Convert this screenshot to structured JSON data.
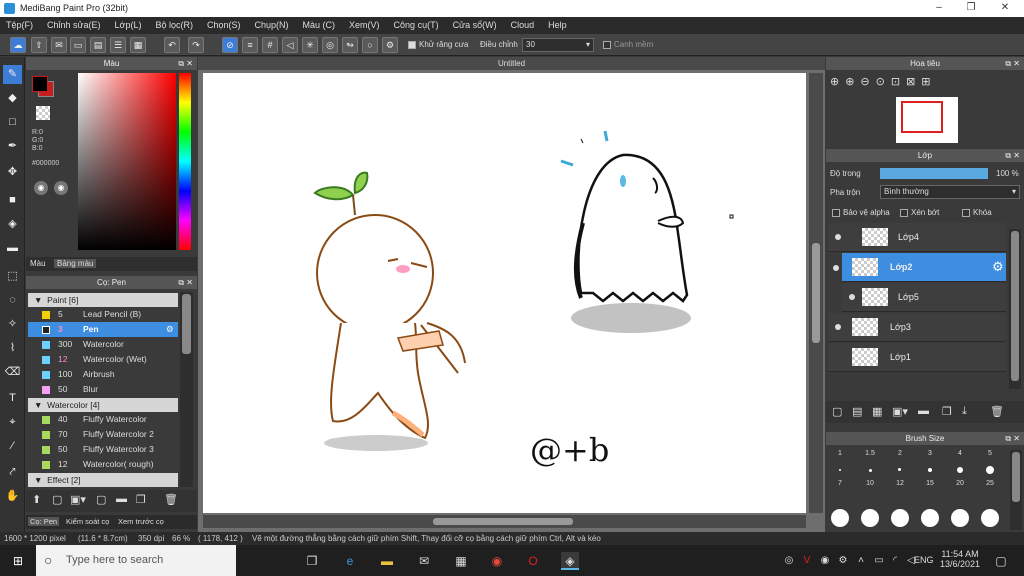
{
  "window": {
    "title": "MediBang Paint Pro (32bit)",
    "minimize": "–",
    "maximize": "❐",
    "close": "✕"
  },
  "menu": [
    "Tệp(F)",
    "Chỉnh sửa(E)",
    "Lớp(L)",
    "Bộ lọc(R)",
    "Chọn(S)",
    "Chụp(N)",
    "Màu (C)",
    "Xem(V)",
    "Công cụ(T)",
    "Cửa sổ(W)",
    "Cloud",
    "Help"
  ],
  "toolbar": {
    "antialias": "Khử răng cưa",
    "adjust_label": "Điều chỉnh",
    "adjust_value": "30",
    "smooth_label": "Canh mềm"
  },
  "color_panel": {
    "title": "Màu",
    "r": "R:0",
    "g": "G:0",
    "b": "B:0",
    "hex": "#000000",
    "tab1": "Màu",
    "tab2": "Bảng màu",
    "fg": "#000000",
    "bg": "#c41e1e"
  },
  "brush_panel": {
    "title": "Cọ: Pen",
    "groups": [
      {
        "name": "Paint [6]",
        "items": [
          {
            "size": "5",
            "name": "Lead Pencil (B)",
            "color": "#f5d000"
          },
          {
            "size": "3",
            "name": "Pen",
            "color": "#222222",
            "selected": true
          },
          {
            "size": "300",
            "name": "Watercolor",
            "color": "#6fd0ff"
          },
          {
            "size": "12",
            "name": "Watercolor (Wet)",
            "color": "#6fd0ff"
          },
          {
            "size": "100",
            "name": "Airbrush",
            "color": "#6fd0ff"
          },
          {
            "size": "50",
            "name": "Blur",
            "color": "#f5a0f5"
          }
        ]
      },
      {
        "name": "Watercolor [4]",
        "items": [
          {
            "size": "40",
            "name": "Fluffy Watercolor",
            "color": "#a8d860"
          },
          {
            "size": "70",
            "name": "Fluffy Watercolor 2",
            "color": "#a8d860"
          },
          {
            "size": "50",
            "name": "Fluffy Watercolor 3",
            "color": "#a8d860"
          },
          {
            "size": "12",
            "name": "Watercolor( rough)",
            "color": "#a8d860"
          }
        ]
      },
      {
        "name": "Effect [2]",
        "items": []
      }
    ],
    "tabs": [
      "Cọ: Pen",
      "Kiểm soát cọ",
      "Xem trước cọ"
    ]
  },
  "canvas": {
    "title": "Untitled",
    "signature": "@+b"
  },
  "navigator": {
    "title": "Hoa tiêu"
  },
  "layer_panel": {
    "title": "Lớp",
    "opacity_label": "Độ trong",
    "opacity_value": "100 %",
    "opacity": 1.0,
    "blend_label": "Pha trộn",
    "blend_value": "Bình thường",
    "protect_alpha": "Bảo vệ alpha",
    "clipping": "Xén bớt",
    "lock": "Khóa",
    "layers": [
      {
        "name": "Lớp4",
        "selected": false
      },
      {
        "name": "Lớp2",
        "selected": true
      },
      {
        "name": "Lớp5",
        "selected": false
      },
      {
        "name": "Lớp3",
        "selected": false
      },
      {
        "name": "Lớp1",
        "selected": false
      }
    ]
  },
  "brush_size": {
    "title": "Brush Size",
    "sizes": [
      "1",
      "1.5",
      "2",
      "3",
      "4",
      "5",
      "7",
      "10",
      "12",
      "15",
      "20",
      "25"
    ]
  },
  "status": {
    "dims": "1600 * 1200 pixel",
    "inches": "(11.6 * 8.7cm)",
    "dpi": "350 dpi",
    "zoom": "66 %",
    "coords": "( 1178, 412 )",
    "hint": "Vẽ một đường thẳng bằng cách giữ phím Shift, Thay đổi cỡ cọ bằng cách giữ phím Ctrl, Alt và kéo"
  },
  "taskbar": {
    "search_placeholder": "Type here to search",
    "time": "11:54 AM",
    "date": "13/6/2021",
    "lang": "ENG"
  }
}
